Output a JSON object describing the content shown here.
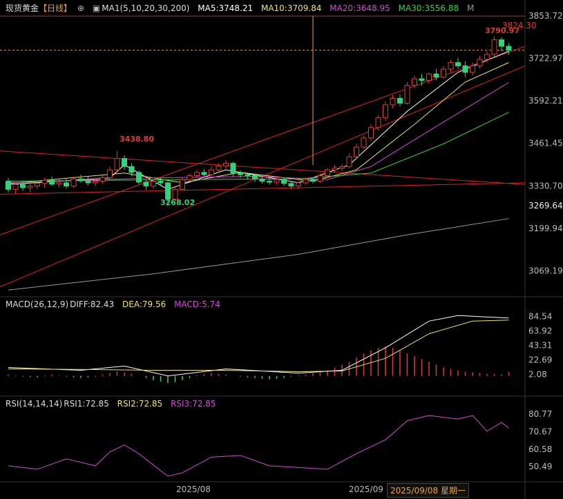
{
  "header": {
    "instrument": "现货黄金",
    "period": "【日线】",
    "target_icon": "⊕",
    "ma_icon": "▣",
    "ma_params": "MA1(5,10,20,30,200)",
    "ma5": "MA5:3748.21",
    "ma10": "MA10:3709.84",
    "ma20": "MA20:3648.95",
    "ma30": "MA30:3556.88",
    "mode_letter": "M"
  },
  "colors": {
    "up": "#e03b3b",
    "down": "#33d17a",
    "ma5": "#ffffff",
    "ma10": "#f0e55a",
    "ma20": "#d44bd4",
    "ma30": "#3bd13b",
    "ma200": "#9a9a9a",
    "trend": "#e02020",
    "crosshair": "#e9a23b"
  },
  "main_axis": {
    "ticks": [
      "3853.72",
      "3722.97",
      "3592.21",
      "3461.45",
      "3330.70",
      "3199.94",
      "3069.19"
    ],
    "crosshair_value": "3824.30",
    "marker_value": "3269.64"
  },
  "annotations": {
    "high_label": "3438.80",
    "low_label": "3268.02",
    "peak_label": "3790.97"
  },
  "macd": {
    "legend": {
      "params": "MACD(26,12,9)",
      "diff": "DIFF:82.43",
      "dea": "DEA:79.56",
      "macd": "MACD:5.74"
    },
    "ticks": [
      "84.54",
      "63.92",
      "43.31",
      "22.69",
      "2.08"
    ]
  },
  "rsi": {
    "legend": {
      "params": "RSI(14,14,14)",
      "rsi1": "RSI1:72.85",
      "rsi2": "RSI2:72.85",
      "rsi3": "RSI3:72.85"
    },
    "ticks": [
      "80.77",
      "70.67",
      "60.58",
      "50.49"
    ]
  },
  "dates": {
    "aug": "2025/08",
    "sep": "2025/09",
    "selected": "2025/09/08 星期一"
  },
  "chart_data": {
    "type": "candlestick",
    "ylim": [
      3000,
      3860
    ],
    "candles": [
      [
        3345,
        3320,
        3355,
        3310
      ],
      [
        3320,
        3335,
        3340,
        3305
      ],
      [
        3335,
        3325,
        3345,
        3315
      ],
      [
        3325,
        3330,
        3340,
        3310
      ],
      [
        3330,
        3338,
        3345,
        3320
      ],
      [
        3338,
        3348,
        3355,
        3325
      ],
      [
        3348,
        3336,
        3360,
        3330
      ],
      [
        3336,
        3340,
        3350,
        3325
      ],
      [
        3340,
        3330,
        3352,
        3322
      ],
      [
        3330,
        3352,
        3360,
        3325
      ],
      [
        3352,
        3346,
        3365,
        3340
      ],
      [
        3346,
        3340,
        3360,
        3332
      ],
      [
        3340,
        3345,
        3355,
        3330
      ],
      [
        3345,
        3356,
        3365,
        3338
      ],
      [
        3356,
        3380,
        3390,
        3350
      ],
      [
        3380,
        3415,
        3438.8,
        3375
      ],
      [
        3415,
        3390,
        3425,
        3380
      ],
      [
        3390,
        3372,
        3400,
        3360
      ],
      [
        3372,
        3342,
        3378,
        3335
      ],
      [
        3342,
        3330,
        3350,
        3318
      ],
      [
        3330,
        3345,
        3350,
        3322
      ],
      [
        3345,
        3340,
        3356,
        3330
      ],
      [
        3340,
        3290,
        3345,
        3268
      ],
      [
        3290,
        3320,
        3325,
        3280
      ],
      [
        3320,
        3350,
        3355,
        3318
      ],
      [
        3350,
        3362,
        3368,
        3345
      ],
      [
        3362,
        3372,
        3380,
        3355
      ],
      [
        3372,
        3365,
        3382,
        3355
      ],
      [
        3365,
        3380,
        3390,
        3360
      ],
      [
        3380,
        3392,
        3400,
        3372
      ],
      [
        3392,
        3400,
        3410,
        3385
      ],
      [
        3400,
        3370,
        3405,
        3358
      ],
      [
        3370,
        3365,
        3378,
        3355
      ],
      [
        3365,
        3362,
        3372,
        3352
      ],
      [
        3362,
        3352,
        3368,
        3342
      ],
      [
        3352,
        3345,
        3360,
        3338
      ],
      [
        3345,
        3342,
        3356,
        3335
      ],
      [
        3342,
        3350,
        3358,
        3335
      ],
      [
        3350,
        3338,
        3356,
        3330
      ],
      [
        3338,
        3330,
        3346,
        3322
      ],
      [
        3330,
        3340,
        3345,
        3320
      ],
      [
        3340,
        3350,
        3356,
        3335
      ],
      [
        3350,
        3345,
        3356,
        3338
      ],
      [
        3345,
        3362,
        3368,
        3340
      ],
      [
        3362,
        3380,
        3385,
        3355
      ],
      [
        3380,
        3385,
        3395,
        3372
      ],
      [
        3385,
        3390,
        3398,
        3378
      ],
      [
        3390,
        3420,
        3430,
        3385
      ],
      [
        3420,
        3450,
        3460,
        3415
      ],
      [
        3450,
        3478,
        3485,
        3445
      ],
      [
        3478,
        3510,
        3520,
        3470
      ],
      [
        3510,
        3540,
        3548,
        3500
      ],
      [
        3540,
        3580,
        3590,
        3530
      ],
      [
        3580,
        3600,
        3610,
        3570
      ],
      [
        3600,
        3585,
        3612,
        3575
      ],
      [
        3585,
        3640,
        3650,
        3580
      ],
      [
        3640,
        3660,
        3670,
        3630
      ],
      [
        3660,
        3655,
        3675,
        3640
      ],
      [
        3655,
        3675,
        3680,
        3645
      ],
      [
        3675,
        3665,
        3690,
        3655
      ],
      [
        3665,
        3690,
        3700,
        3660
      ],
      [
        3690,
        3710,
        3718,
        3680
      ],
      [
        3710,
        3700,
        3725,
        3690
      ],
      [
        3700,
        3680,
        3715,
        3665
      ],
      [
        3680,
        3700,
        3710,
        3670
      ],
      [
        3700,
        3720,
        3730,
        3692
      ],
      [
        3720,
        3735,
        3745,
        3710
      ],
      [
        3735,
        3780,
        3790.97,
        3728
      ],
      [
        3780,
        3760,
        3788,
        3745
      ],
      [
        3760,
        3748,
        3770,
        3735
      ]
    ],
    "ma_lines": {
      "MA5": [
        [
          0,
          3335
        ],
        [
          14,
          3355
        ],
        [
          16,
          3395
        ],
        [
          22,
          3320
        ],
        [
          30,
          3380
        ],
        [
          40,
          3340
        ],
        [
          47,
          3395
        ],
        [
          55,
          3560
        ],
        [
          62,
          3680
        ],
        [
          69,
          3745
        ]
      ],
      "MA10": [
        [
          0,
          3338
        ],
        [
          16,
          3370
        ],
        [
          24,
          3340
        ],
        [
          32,
          3372
        ],
        [
          42,
          3345
        ],
        [
          48,
          3380
        ],
        [
          56,
          3520
        ],
        [
          63,
          3650
        ],
        [
          69,
          3710
        ]
      ],
      "MA20": [
        [
          0,
          3340
        ],
        [
          20,
          3355
        ],
        [
          34,
          3360
        ],
        [
          44,
          3350
        ],
        [
          50,
          3390
        ],
        [
          58,
          3500
        ],
        [
          69,
          3649
        ]
      ],
      "MA30": [
        [
          0,
          3345
        ],
        [
          24,
          3350
        ],
        [
          40,
          3352
        ],
        [
          50,
          3370
        ],
        [
          60,
          3460
        ],
        [
          69,
          3557
        ]
      ],
      "MA200": [
        [
          0,
          3010
        ],
        [
          20,
          3060
        ],
        [
          40,
          3120
        ],
        [
          55,
          3180
        ],
        [
          69,
          3230
        ]
      ]
    },
    "macd": {
      "ylim": [
        -20,
        95
      ],
      "diff": [
        [
          0,
          12
        ],
        [
          10,
          8
        ],
        [
          16,
          14
        ],
        [
          22,
          0
        ],
        [
          30,
          10
        ],
        [
          40,
          4
        ],
        [
          46,
          8
        ],
        [
          52,
          40
        ],
        [
          58,
          78
        ],
        [
          62,
          86
        ],
        [
          66,
          84
        ],
        [
          69,
          82.43
        ]
      ],
      "dea": [
        [
          0,
          10
        ],
        [
          12,
          9
        ],
        [
          20,
          8
        ],
        [
          30,
          8
        ],
        [
          40,
          6
        ],
        [
          46,
          7
        ],
        [
          52,
          25
        ],
        [
          58,
          60
        ],
        [
          64,
          78
        ],
        [
          69,
          79.56
        ]
      ],
      "hist": [
        2,
        1,
        -1,
        -2,
        -2,
        1,
        2,
        1,
        -1,
        -2,
        -3,
        -2,
        -1,
        2,
        4,
        6,
        5,
        3,
        0,
        -3,
        -6,
        -8,
        -10,
        -9,
        -6,
        -3,
        1,
        3,
        4,
        3,
        2,
        0,
        -1,
        -2,
        -3,
        -4,
        -5,
        -4,
        -3,
        -1,
        1,
        2,
        4,
        6,
        8,
        12,
        16,
        20,
        26,
        32,
        36,
        40,
        42,
        40,
        36,
        32,
        28,
        24,
        20,
        16,
        12,
        10,
        8,
        6,
        5,
        4,
        3,
        3,
        2,
        5.74
      ]
    },
    "rsi": {
      "ylim": [
        43,
        84
      ],
      "rsi1": [
        [
          0,
          51
        ],
        [
          4,
          49
        ],
        [
          8,
          55
        ],
        [
          12,
          51
        ],
        [
          14,
          59
        ],
        [
          16,
          63
        ],
        [
          18,
          58
        ],
        [
          22,
          45
        ],
        [
          24,
          47
        ],
        [
          28,
          56
        ],
        [
          32,
          57
        ],
        [
          36,
          51
        ],
        [
          40,
          50
        ],
        [
          44,
          49
        ],
        [
          48,
          58
        ],
        [
          52,
          66
        ],
        [
          55,
          77
        ],
        [
          58,
          80
        ],
        [
          62,
          78
        ],
        [
          64,
          80
        ],
        [
          66,
          71
        ],
        [
          68,
          76
        ],
        [
          69,
          72.85
        ]
      ]
    }
  }
}
